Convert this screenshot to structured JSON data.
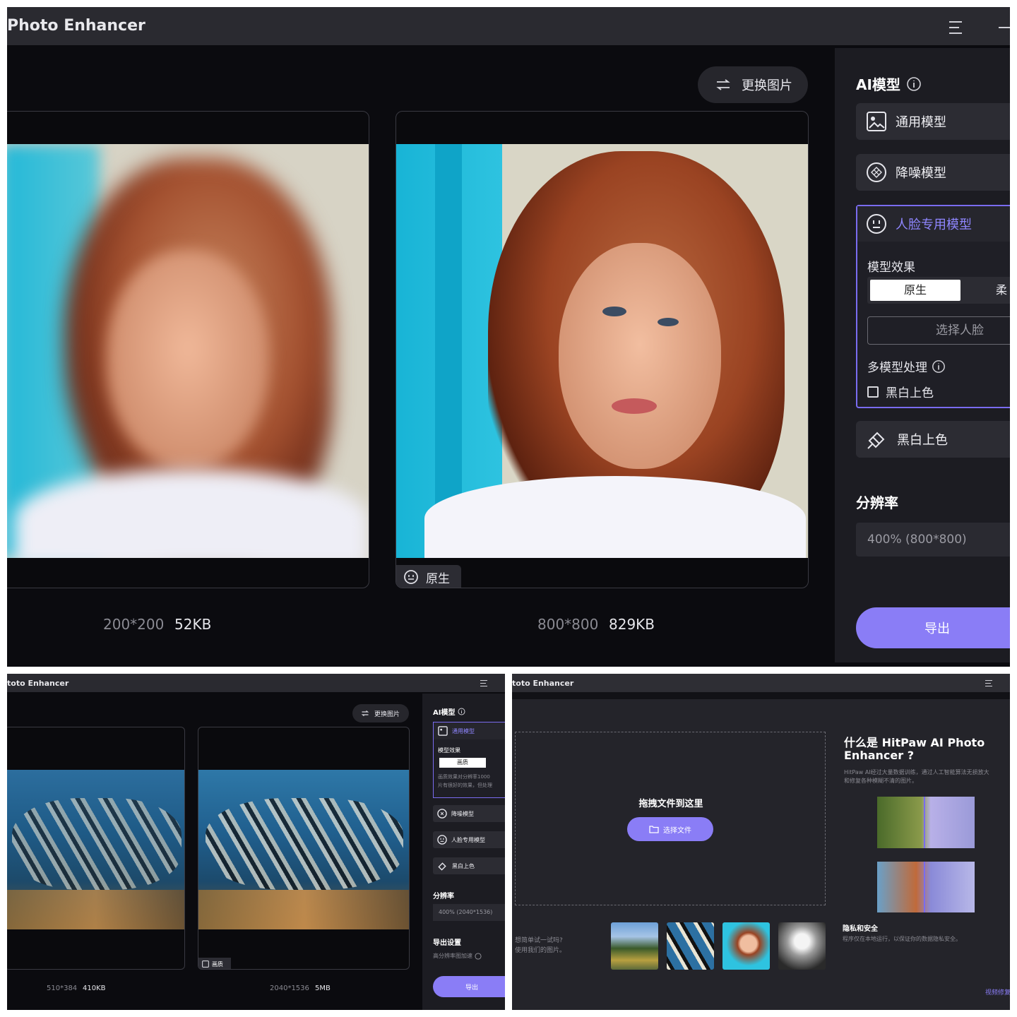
{
  "app": {
    "title": "Photo Enhancer",
    "title_small": "toto Enhancer"
  },
  "top": {
    "replace_label": "更换图片",
    "ai_model_label": "AI模型",
    "models": [
      "通用模型",
      "降噪模型",
      "人脸专用模型",
      "黑白上色"
    ],
    "effect_label": "模型效果",
    "effect_options": [
      "原生",
      "柔"
    ],
    "select_face": "选择人脸",
    "multi_label": "多模型处理",
    "bw_checkbox": "黑白上色",
    "resolution_label": "分辨率",
    "resolution_value": "400% (800*800)",
    "export_label": "导出",
    "badge_label": "原生",
    "left_dim": "200*200",
    "left_size": "52KB",
    "right_dim": "800*800",
    "right_size": "829KB"
  },
  "bottom_left": {
    "replace_label": "更换图片",
    "ai_model_label": "AI模型",
    "active_model": "通用模型",
    "effect_label": "模型效果",
    "effect_option": "画质",
    "effect_note_1": "画质效果对分辨率1000",
    "effect_note_2": "片有很好的效果，但处理",
    "models": [
      "降噪模型",
      "人脸专用模型",
      "黑白上色"
    ],
    "resolution_label": "分辨率",
    "resolution_value": "400% (2040*1536)",
    "export_settings": "导出设置",
    "accelerate": "高分辨率图加速",
    "export_label": "导出",
    "badge_label": "画质",
    "left_dim": "510*384",
    "left_size": "410KB",
    "right_dim": "2040*1536",
    "right_size": "5MB"
  },
  "bottom_right": {
    "drop_label": "拖拽文件到这里",
    "choose_label": "选择文件",
    "try_line1": "想简单试一试吗?",
    "try_line2": "使用我们的图片。",
    "about_title_1": "什么是 HitPaw AI Photo",
    "about_title_2": "Enhancer ?",
    "about_desc_1": "HitPaw AI经过大量数据训练，通过人工智能算法无损放大",
    "about_desc_2": "和修复各种模糊不清的图片。",
    "privacy_title": "隐私和安全",
    "privacy_desc": "程序仅在本地运行，以保证你的数据隐私安全。",
    "video_link": "视频修复"
  },
  "colors": {
    "accent": "#8a7df6",
    "panel": "#0b0b0f",
    "sidebar": "#1c1c22"
  }
}
